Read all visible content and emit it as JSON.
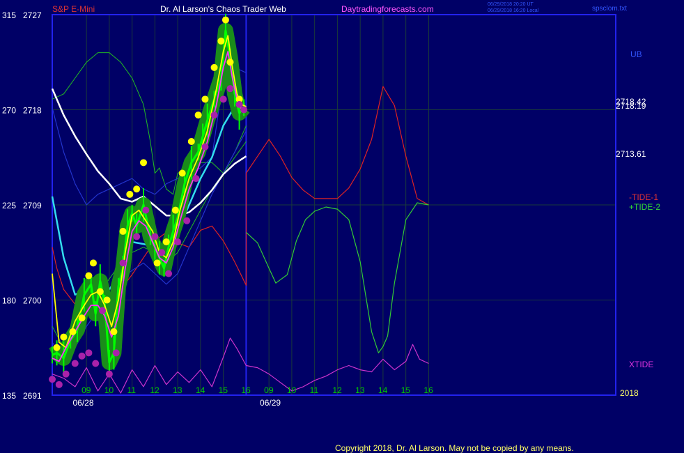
{
  "header": {
    "symbol": "S&P E-Mini",
    "title": "Dr. Al Larson's Chaos Trader Web",
    "site": "Daytradingforecasts.com",
    "timestamp_1": "06/29/2018 20:20 UT",
    "timestamp_2": "06/29/2018 16:20 Local",
    "filename": "spsclom.txt"
  },
  "footer": {
    "copyright": "Copyright 2018, Dr. Al Larson. May not be copied by any means."
  },
  "colors": {
    "background": "#000066",
    "grid": "#1a3a3a",
    "frame": "#2222ee",
    "price": "#00ff00",
    "price_halo": "#1a8c1a",
    "high_dot": "#ffff00",
    "low_dot": "#aa22aa",
    "yellow_line": "#ffff00",
    "magenta_line": "#ff33ff",
    "white_ma": "#ffffff",
    "cyan_ma": "#33ddee",
    "band": "#2233cc",
    "envelope": "#22bb22",
    "tide1": "#dd2222",
    "tide2": "#33cc33",
    "xtide": "#cc33cc"
  },
  "chart_data": {
    "type": "line",
    "title": "S&P E-Mini",
    "y_left_oscillator": {
      "ticks": [
        135,
        180,
        225,
        270,
        315
      ],
      "range": [
        135,
        315
      ]
    },
    "y_left_price": {
      "ticks": [
        2691,
        2700,
        2709,
        2718,
        2727
      ],
      "range": [
        2691,
        2727
      ]
    },
    "x": {
      "range": [
        7.5,
        32.2
      ],
      "hour_ticks": [
        {
          "x": 9,
          "label": "09"
        },
        {
          "x": 10,
          "label": "10"
        },
        {
          "x": 11,
          "label": "11"
        },
        {
          "x": 12,
          "label": "12"
        },
        {
          "x": 13,
          "label": "13"
        },
        {
          "x": 14,
          "label": "14"
        },
        {
          "x": 15,
          "label": "15"
        },
        {
          "x": 16,
          "label": "16"
        },
        {
          "x": 17,
          "label": "09"
        },
        {
          "x": 18,
          "label": "10"
        },
        {
          "x": 19,
          "label": "11"
        },
        {
          "x": 20,
          "label": "12"
        },
        {
          "x": 21,
          "label": "13"
        },
        {
          "x": 22,
          "label": "14"
        },
        {
          "x": 23,
          "label": "15"
        },
        {
          "x": 24,
          "label": "16"
        }
      ],
      "date_labels": [
        {
          "x": 8.4,
          "label": "06/28"
        },
        {
          "x": 16.6,
          "label": "06/29"
        }
      ],
      "year_label": "2018",
      "now_line": 16
    },
    "right_labels": {
      "ub": "UB",
      "value_a": "2718.42",
      "value_b": "2718.19",
      "value_c": "2713.61",
      "tide1": "-TIDE-1",
      "tide2": "+TIDE-2",
      "xtide": "XTIDE"
    },
    "series": [
      {
        "name": "S&P E-Mini",
        "units": "price",
        "x": [
          7.5,
          7.7,
          8.0,
          8.3,
          8.6,
          8.9,
          9.2,
          9.4,
          9.6,
          9.8,
          10.0,
          10.2,
          10.4,
          10.6,
          10.8,
          11.0,
          11.2,
          11.5,
          11.8,
          12.0,
          12.2,
          12.4,
          12.6,
          12.8,
          13.0,
          13.3,
          13.6,
          13.9,
          14.1,
          14.3,
          14.6,
          14.9,
          15.1,
          15.3,
          15.5,
          15.7,
          15.9
        ],
        "y": [
          2694.8,
          2695.0,
          2694.5,
          2696.2,
          2697.2,
          2700.5,
          2701.5,
          2698.7,
          2701.8,
          2699.7,
          2694.1,
          2695.0,
          2701.3,
          2703.0,
          2707.0,
          2708.2,
          2707.0,
          2709.0,
          2706.0,
          2705.0,
          2704.0,
          2703.0,
          2705.0,
          2706.5,
          2707.8,
          2711.0,
          2713.0,
          2714.0,
          2715.5,
          2717.0,
          2719.0,
          2721.0,
          2725.5,
          2723.0,
          2719.5,
          2717.7,
          2718.2
        ]
      },
      {
        "name": "Highs",
        "units": "price",
        "x": [
          7.7,
          8.0,
          8.4,
          8.8,
          9.1,
          9.3,
          9.6,
          9.9,
          10.2,
          10.6,
          10.9,
          11.2,
          11.5,
          12.1,
          12.5,
          12.9,
          13.2,
          13.6,
          13.9,
          14.2,
          14.6,
          14.9,
          15.1,
          15.3,
          15.7
        ],
        "y": [
          2695.5,
          2696.5,
          2697.0,
          2698.3,
          2702.3,
          2703.5,
          2700.8,
          2700.0,
          2697.0,
          2706.5,
          2710.0,
          2710.5,
          2713.0,
          2703.5,
          2705.5,
          2708.5,
          2712.0,
          2715.0,
          2717.5,
          2719.0,
          2722.0,
          2724.5,
          2726.5,
          2722.5,
          2719.0
        ]
      },
      {
        "name": "Lows",
        "units": "price",
        "x": [
          7.5,
          7.8,
          8.1,
          8.5,
          8.8,
          9.1,
          9.4,
          9.7,
          10.0,
          10.3,
          10.6,
          11.2,
          11.6,
          12.0,
          12.3,
          12.6,
          13.0,
          13.4,
          13.8,
          14.2,
          14.6,
          15.0,
          15.3,
          15.7,
          15.9
        ],
        "y": [
          2692.5,
          2692.0,
          2693.0,
          2694.0,
          2694.7,
          2695.0,
          2694.0,
          2699.0,
          2693.0,
          2695.0,
          2703.5,
          2706.0,
          2708.5,
          2706.0,
          2704.5,
          2702.5,
          2705.5,
          2707.5,
          2711.5,
          2714.5,
          2717.5,
          2719.0,
          2720.0,
          2718.5,
          2718.0
        ]
      },
      {
        "name": "Yellow",
        "units": "price",
        "x": [
          7.5,
          7.8,
          8.1,
          8.5,
          8.9,
          9.2,
          9.5,
          9.8,
          10.1,
          10.4,
          10.7,
          11.0,
          11.3,
          11.6,
          11.9,
          12.2,
          12.5,
          12.8,
          13.1,
          13.5,
          13.9,
          14.3,
          14.7,
          15.0,
          15.2,
          15.4,
          15.6,
          15.8,
          16.0
        ],
        "y": [
          2702.5,
          2696.0,
          2695.5,
          2698.0,
          2699.5,
          2700.5,
          2700.8,
          2699.5,
          2697.5,
          2700.0,
          2704.5,
          2708.0,
          2708.5,
          2707.5,
          2706.5,
          2704.5,
          2704.0,
          2705.5,
          2708.5,
          2711.5,
          2713.5,
          2716.0,
          2720.0,
          2723.5,
          2725.0,
          2722.0,
          2719.5,
          2718.5,
          2718.3
        ]
      },
      {
        "name": "Magenta",
        "units": "price",
        "x": [
          7.5,
          7.8,
          8.1,
          8.5,
          8.9,
          9.2,
          9.5,
          9.8,
          10.1,
          10.4,
          10.7,
          11.0,
          11.3,
          11.6,
          11.9,
          12.2,
          12.5,
          12.8,
          13.1,
          13.5,
          13.9,
          14.3,
          14.7,
          15.0,
          15.2,
          15.4,
          15.6,
          15.8,
          16.0
        ],
        "y": [
          2694.5,
          2694.2,
          2695.5,
          2697.0,
          2698.5,
          2699.5,
          2699.5,
          2698.5,
          2696.5,
          2698.5,
          2703.0,
          2706.5,
          2707.5,
          2707.0,
          2705.5,
          2704.0,
          2703.5,
          2705.0,
          2707.5,
          2710.5,
          2712.5,
          2715.0,
          2718.5,
          2722.0,
          2723.5,
          2721.0,
          2719.0,
          2718.0,
          2718.0
        ]
      },
      {
        "name": "White",
        "units": "price",
        "x": [
          7.5,
          8.0,
          8.5,
          9.0,
          9.5,
          10.0,
          10.5,
          11.0,
          11.5,
          12.0,
          12.5,
          13.0,
          13.5,
          14.0,
          14.5,
          15.0,
          15.5,
          16.0
        ],
        "y": [
          2720.0,
          2717.5,
          2715.5,
          2713.8,
          2712.2,
          2711.0,
          2709.6,
          2709.3,
          2709.8,
          2708.9,
          2708.0,
          2708.0,
          2708.3,
          2709.2,
          2710.4,
          2711.9,
          2712.9,
          2713.6
        ]
      },
      {
        "name": "Cyan",
        "units": "price",
        "x": [
          7.5,
          8.0,
          8.5,
          9.0,
          9.5,
          10.0,
          10.5,
          11.0,
          11.5,
          12.0,
          12.5,
          13.0,
          13.5,
          14.0,
          14.5,
          15.0,
          15.5,
          16.0
        ],
        "y": [
          2709.8,
          2704.0,
          2700.5,
          2701.0,
          2701.2,
          2701.0,
          2702.5,
          2705.5,
          2705.3,
          2705.0,
          2704.2,
          2706.5,
          2709.0,
          2711.5,
          2713.5,
          2716.5,
          2718.3,
          2718.2
        ]
      },
      {
        "name": "Band",
        "units": "price",
        "x": [
          7.5,
          8.0,
          8.5,
          9.0,
          9.5,
          10.0,
          10.5,
          11.0,
          11.5,
          12.0,
          12.5,
          13.0,
          13.5,
          14.0,
          14.5,
          15.0,
          15.5,
          16.0
        ],
        "y": [
          2718.2,
          2714.0,
          2711.0,
          2709.0,
          2710.0,
          2710.5,
          2711.0,
          2711.5,
          2710.5,
          2710.0,
          2711.0,
          2711.5,
          2712.0,
          2712.5,
          2713.5,
          2721.0,
          2722.0,
          2721.5
        ]
      },
      {
        "name": "Band",
        "units": "price",
        "x": [
          7.5,
          8.0,
          8.5,
          9.0,
          9.5,
          10.0,
          10.5,
          11.0,
          11.5,
          12.0,
          12.5,
          13.0,
          13.5,
          14.0,
          14.5,
          15.0,
          15.5,
          16.0
        ],
        "y": [
          2696.0,
          2694.5,
          2695.5,
          2697.5,
          2699.0,
          2700.5,
          2702.0,
          2702.8,
          2703.5,
          2702.5,
          2701.5,
          2702.5,
          2705.0,
          2707.5,
          2710.0,
          2712.0,
          2714.0,
          2716.0
        ]
      },
      {
        "name": "Envelope",
        "units": "price",
        "x": [
          7.5,
          8.0,
          8.5,
          9.0,
          9.5,
          10.0,
          10.5,
          11.0,
          11.5,
          11.8,
          12.0,
          12.2,
          12.5,
          12.8,
          13.0,
          13.5,
          14.0,
          14.5,
          15.0,
          15.5,
          16.0
        ],
        "y": [
          2719.0,
          2719.5,
          2721.0,
          2722.5,
          2723.4,
          2723.4,
          2722.5,
          2721.0,
          2718.5,
          2715.0,
          2712.0,
          2712.5,
          2710.5,
          2710.0,
          2712.0,
          2712.5,
          2713.0,
          2713.0,
          2712.0,
          2714.0,
          2716.5
        ]
      },
      {
        "name": "Envelope",
        "units": "price",
        "x": [
          7.5,
          8.0,
          8.5,
          9.0,
          9.5,
          10.0,
          10.5,
          11.0,
          11.5,
          12.0,
          12.5,
          13.0,
          13.5,
          14.0,
          14.5,
          15.0,
          15.5,
          16.0
        ],
        "y": [
          2697.5,
          2695.5,
          2696.5,
          2698.5,
          2700.5,
          2702.0,
          2703.5,
          2704.5,
          2705.0,
          2704.5,
          2703.5,
          2704.5,
          2706.5,
          2708.5,
          2710.5,
          2712.0,
          2713.5,
          2715.0
        ]
      },
      {
        "name": "-TIDE-1",
        "units": "oscillator",
        "x": [
          7.5,
          7.7,
          8.0,
          8.5,
          9.0,
          9.5,
          10.0,
          10.5,
          11.0,
          11.5,
          12.0,
          12.5,
          13.0,
          13.5,
          14.0,
          14.5,
          15.0,
          15.5,
          16.0,
          16.0,
          16.5,
          17.0,
          17.5,
          18.0,
          18.5,
          19.0,
          19.5,
          20.0,
          20.5,
          21.0,
          21.5,
          22.0,
          22.5,
          23.0,
          23.5,
          24.0
        ],
        "y": [
          205,
          195,
          185,
          178,
          175,
          176,
          180,
          185,
          192,
          200,
          208,
          212,
          207,
          205,
          213,
          215,
          208,
          198,
          187,
          240,
          248,
          256,
          248,
          238,
          232,
          228,
          228,
          228,
          233,
          242,
          256,
          281,
          272,
          248,
          228,
          225
        ]
      },
      {
        "name": "+TIDE-2",
        "units": "oscillator",
        "x": [
          16.0,
          16.5,
          17.0,
          17.3,
          17.8,
          18.2,
          18.6,
          19.0,
          19.5,
          20.0,
          20.5,
          21.0,
          21.5,
          21.8,
          22.0,
          22.2,
          22.5,
          23.0,
          23.5,
          24.0
        ],
        "y": [
          212,
          207,
          195,
          188,
          192,
          208,
          218,
          222,
          224,
          223,
          218,
          198,
          165,
          155,
          158,
          163,
          188,
          218,
          226,
          225
        ]
      },
      {
        "name": "XTIDE",
        "units": "oscillator",
        "x": [
          7.5,
          8.0,
          8.5,
          9.0,
          9.5,
          10.0,
          10.5,
          11.0,
          11.5,
          12.0,
          12.5,
          13.0,
          13.5,
          14.0,
          14.5,
          15.0,
          15.3,
          15.6,
          16.0,
          16.5,
          17.0,
          17.5,
          18.0,
          18.5,
          19.0,
          19.5,
          20.0,
          20.5,
          21.0,
          21.5,
          22.0,
          22.5,
          23.0,
          23.3,
          23.6,
          24.0
        ],
        "y": [
          145,
          143,
          139,
          148,
          137,
          145,
          136,
          147,
          139,
          149,
          140,
          146,
          141,
          147,
          139,
          153,
          162,
          157,
          149,
          148,
          145,
          141,
          137,
          139,
          142,
          144,
          147,
          149,
          147,
          146,
          152,
          147,
          151,
          159,
          152,
          150
        ]
      }
    ]
  }
}
